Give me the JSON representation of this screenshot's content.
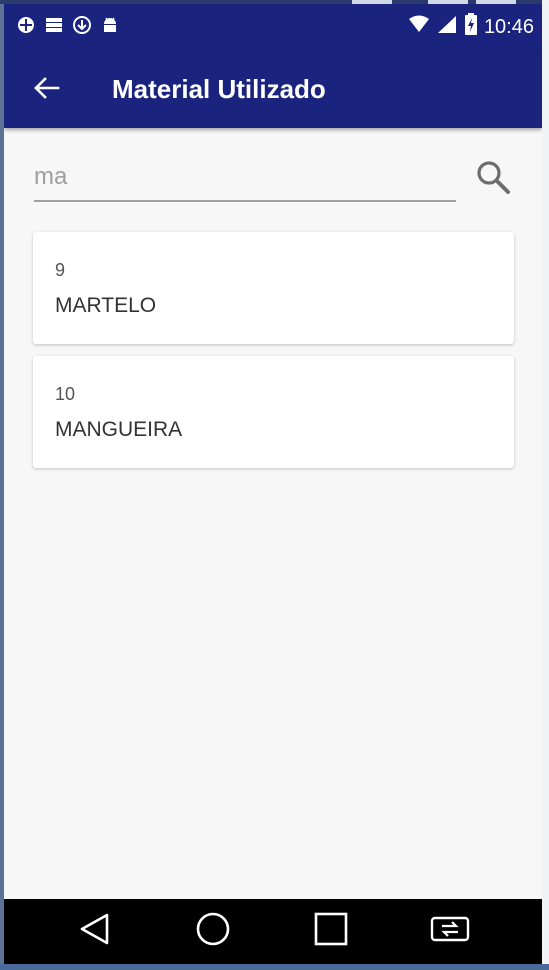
{
  "colors": {
    "primary": "#1a237e",
    "background": "#f7f7f7",
    "card": "#ffffff",
    "nav": "#000000"
  },
  "status_bar": {
    "time": "10:46",
    "left_icons": [
      "bug-report-icon",
      "storage-icon",
      "download-icon",
      "android-icon"
    ],
    "right_icons": [
      "wifi-icon",
      "signal-4g-icon",
      "battery-charging-icon"
    ]
  },
  "app_bar": {
    "title": "Material Utilizado",
    "back_icon": "arrow-back-icon"
  },
  "search": {
    "value": "ma",
    "icon": "search-icon"
  },
  "items": [
    {
      "id": "9",
      "name": "MARTELO"
    },
    {
      "id": "10",
      "name": "MANGUEIRA"
    }
  ],
  "nav_bar": {
    "buttons": [
      "back-triangle-icon",
      "home-circle-icon",
      "recents-square-icon",
      "screen-rotate-icon"
    ]
  }
}
